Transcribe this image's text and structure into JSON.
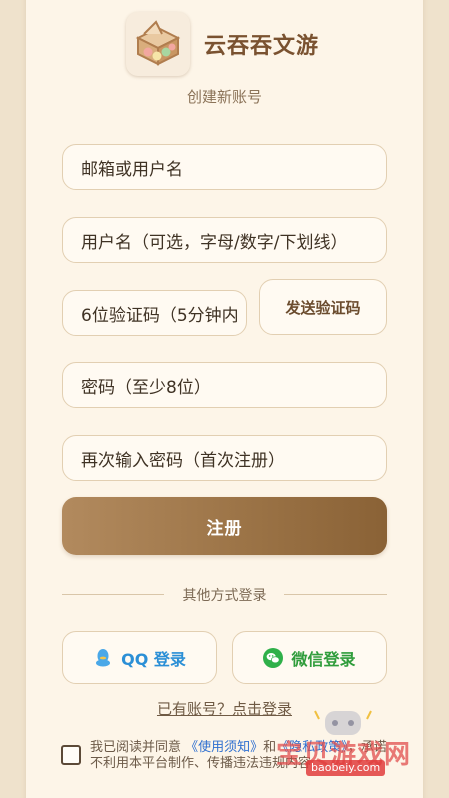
{
  "app": {
    "title": "云吞吞文游",
    "subtitle": "创建新账号",
    "logo_icon": "bento-box-icon"
  },
  "form": {
    "email_placeholder": "邮箱或用户名",
    "username_placeholder": "用户名（可选，字母/数字/下划线）",
    "code_placeholder": "6位验证码（5分钟内",
    "send_code_label": "发送验证码",
    "password_placeholder": "密码（至少8位）",
    "password_confirm_placeholder": "再次输入密码（首次注册）",
    "register_label": "注册"
  },
  "other_login": {
    "divider_label": "其他方式登录",
    "qq_label": "QQ 登录",
    "wechat_label": "微信登录",
    "qq_icon": "qq-penguin-icon",
    "wechat_icon": "wechat-icon"
  },
  "login_link": "已有账号？点击登录",
  "agreement": {
    "prefix": "我已阅读并同意",
    "terms_link": "《使用须知》",
    "middle": "和",
    "privacy_link": "《隐私政策》",
    "suffix": "，承诺不利用本平台制作、传播违法违规内容",
    "checked": false
  },
  "watermark": {
    "text": "宝贝游戏网",
    "url": "baobeiy.com"
  },
  "colors": {
    "background": "#efe2cc",
    "card": "#fdf5e8",
    "accent": "#9c7447",
    "title": "#7a5230",
    "qq": "#2b8fd6",
    "wechat": "#2f9c3b",
    "link": "#2e6fd0"
  }
}
